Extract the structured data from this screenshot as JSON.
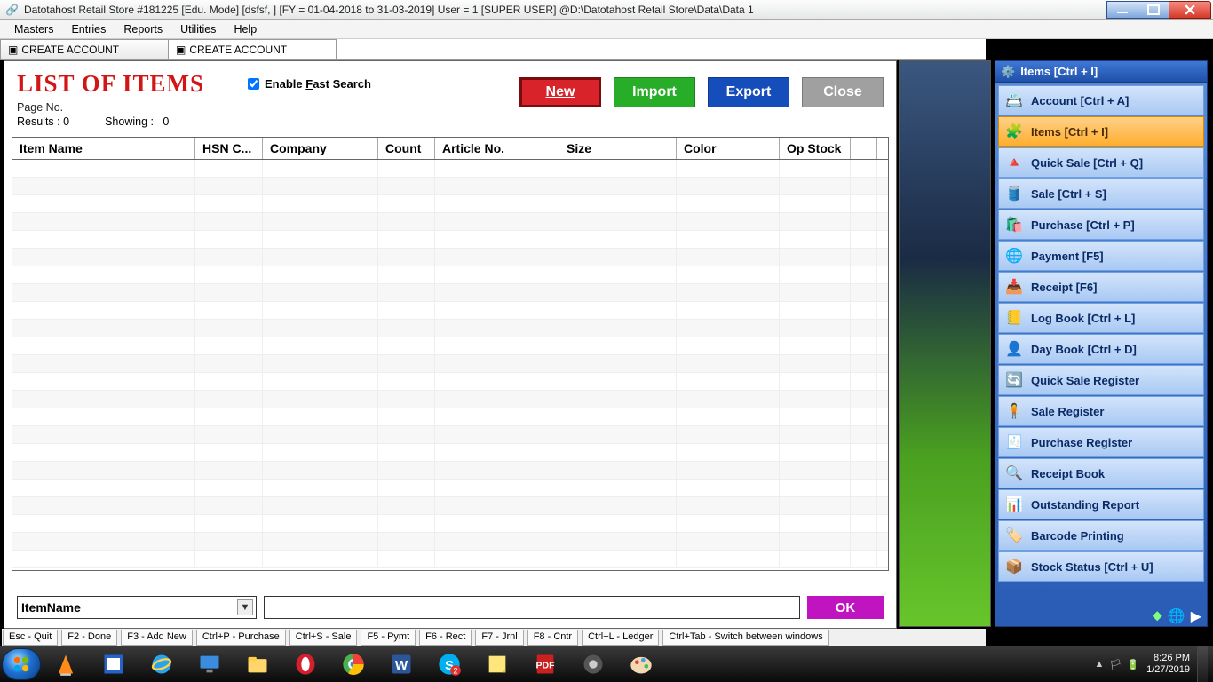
{
  "titlebar": "Datotahost Retail Store #181225  [Edu. Mode]  [dsfsf, ] [FY = 01-04-2018 to 31-03-2019] User = 1 [SUPER USER]  @D:\\Datotahost Retail Store\\Data\\Data 1",
  "menubar": [
    "Masters",
    "Entries",
    "Reports",
    "Utilities",
    "Help"
  ],
  "doc_tabs": [
    {
      "label": "CREATE ACCOUNT",
      "active": false
    },
    {
      "label": "CREATE ACCOUNT",
      "active": true
    }
  ],
  "panel": {
    "title": "LIST OF ITEMS",
    "page_no_label": "Page No.",
    "results_label": "Results :",
    "results_value": "0",
    "showing_label": "Showing :",
    "showing_value": "0",
    "fast_search_label": "Enable Fast Search",
    "fast_search_checked": true,
    "buttons": {
      "new": "New",
      "import": "Import",
      "export": "Export",
      "close": "Close"
    },
    "columns": [
      "Item Name",
      "HSN C...",
      "Company",
      "Count",
      "Article No.",
      "Size",
      "Color",
      "Op Stock"
    ],
    "footer": {
      "select_value": "ItemName",
      "input_value": "",
      "ok": "OK"
    }
  },
  "right_panel": {
    "header": "Items [Ctrl + I]",
    "items": [
      {
        "icon": "📇",
        "label": "Account [Ctrl + A]",
        "active": false
      },
      {
        "icon": "🧩",
        "label": "Items [Ctrl + I]",
        "active": true
      },
      {
        "icon": "🔺",
        "label": "Quick Sale [Ctrl + Q]",
        "active": false
      },
      {
        "icon": "🛢️",
        "label": "Sale [Ctrl + S]",
        "active": false
      },
      {
        "icon": "🛍️",
        "label": "Purchase [Ctrl + P]",
        "active": false
      },
      {
        "icon": "🌐",
        "label": "Payment [F5]",
        "active": false
      },
      {
        "icon": "📥",
        "label": "Receipt [F6]",
        "active": false
      },
      {
        "icon": "📒",
        "label": "Log Book [Ctrl + L]",
        "active": false
      },
      {
        "icon": "👤",
        "label": "Day Book [Ctrl + D]",
        "active": false
      },
      {
        "icon": "🔄",
        "label": "Quick Sale Register",
        "active": false
      },
      {
        "icon": "🧍",
        "label": "Sale Register",
        "active": false
      },
      {
        "icon": "🧾",
        "label": "Purchase Register",
        "active": false
      },
      {
        "icon": "🔍",
        "label": "Receipt Book",
        "active": false
      },
      {
        "icon": "📊",
        "label": "Outstanding Report",
        "active": false
      },
      {
        "icon": "🏷️",
        "label": "Barcode Printing",
        "active": false
      },
      {
        "icon": "📦",
        "label": "Stock Status [Ctrl + U]",
        "active": false
      }
    ]
  },
  "shortcut_bar": [
    "Esc - Quit",
    "F2 - Done",
    "F3 - Add New",
    "Ctrl+P - Purchase",
    "Ctrl+S - Sale",
    "F5 - Pymt",
    "F6 - Rect",
    "F7 - Jrnl",
    "F8 - Cntr",
    "Ctrl+L - Ledger",
    "Ctrl+Tab - Switch between windows"
  ],
  "taskbar": {
    "items": [
      "start",
      "vlc",
      "gimp",
      "ie",
      "monitor",
      "explorer",
      "opera",
      "chrome",
      "word",
      "skype",
      "stickies",
      "pdf",
      "tool",
      "paint"
    ],
    "time": "8:26 PM",
    "date": "1/27/2019"
  }
}
